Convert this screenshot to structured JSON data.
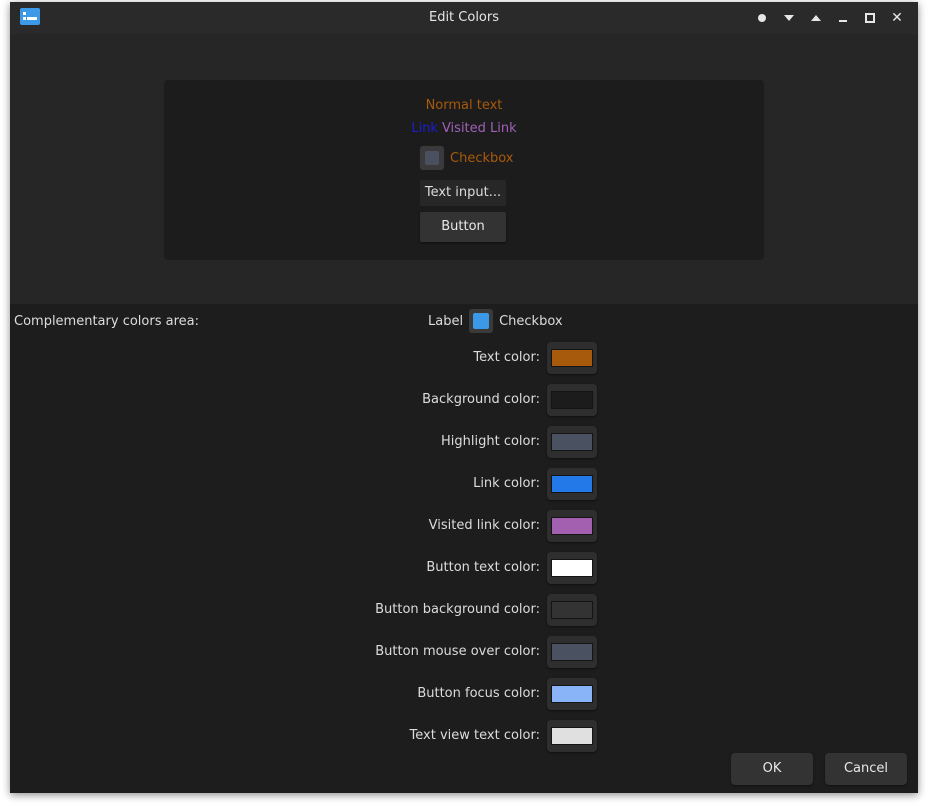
{
  "window": {
    "title": "Edit Colors",
    "titlebar_buttons": [
      "dot-icon",
      "chevron-down-icon",
      "chevron-up-icon",
      "minimize-icon",
      "maximize-icon",
      "close-icon"
    ]
  },
  "preview": {
    "normal_text": "Normal text",
    "link": "Link",
    "visited_link": "Visited Link",
    "checkbox_label": "Checkbox",
    "text_input": "Text input...",
    "button": "Button"
  },
  "complementary": {
    "area_label": "Complementary colors area:",
    "label": "Label",
    "checkbox_label": "Checkbox"
  },
  "color_rows": [
    {
      "label": "Text color:",
      "color": "#a85a0c"
    },
    {
      "label": "Background color:",
      "color": "#1c1c1c"
    },
    {
      "label": "Highlight color:",
      "color": "#4a5261"
    },
    {
      "label": "Link color:",
      "color": "#2479e8"
    },
    {
      "label": "Visited link color:",
      "color": "#a460b0"
    },
    {
      "label": "Button text color:",
      "color": "#ffffff"
    },
    {
      "label": "Button background color:",
      "color": "#333333"
    },
    {
      "label": "Button mouse over color:",
      "color": "#4a5261"
    },
    {
      "label": "Button focus color:",
      "color": "#8ab4f8"
    },
    {
      "label": "Text view text color:",
      "color": "#e0e0e0"
    }
  ],
  "dialog_buttons": {
    "ok": "OK",
    "cancel": "Cancel"
  }
}
